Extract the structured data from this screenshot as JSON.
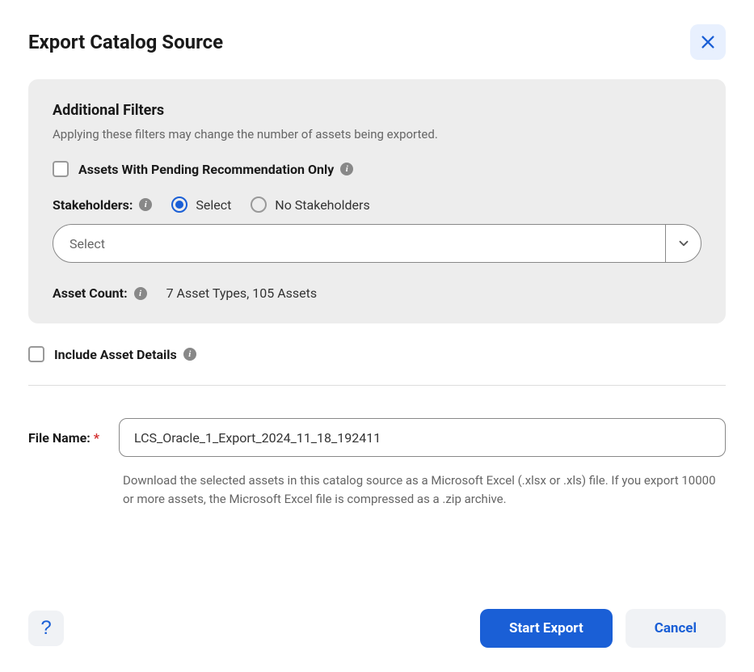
{
  "dialog": {
    "title": "Export Catalog Source"
  },
  "filters": {
    "title": "Additional Filters",
    "subtitle": "Applying these filters may change the number of assets being exported.",
    "pending_recommendation_label": "Assets With Pending Recommendation Only",
    "stakeholders_label": "Stakeholders:",
    "radio_select_label": "Select",
    "radio_no_stakeholders_label": "No Stakeholders",
    "select_placeholder": "Select",
    "asset_count_label": "Asset Count:",
    "asset_count_value": "7 Asset Types, 105 Assets"
  },
  "include_details_label": "Include Asset Details",
  "filename": {
    "label": "File Name:",
    "value": "LCS_Oracle_1_Export_2024_11_18_192411",
    "help": "Download the selected assets in this catalog source as a Microsoft Excel (.xlsx or .xls) file. If you export 10000 or more assets, the Microsoft Excel file is compressed as a .zip archive."
  },
  "footer": {
    "help": "?",
    "start_export": "Start Export",
    "cancel": "Cancel"
  }
}
